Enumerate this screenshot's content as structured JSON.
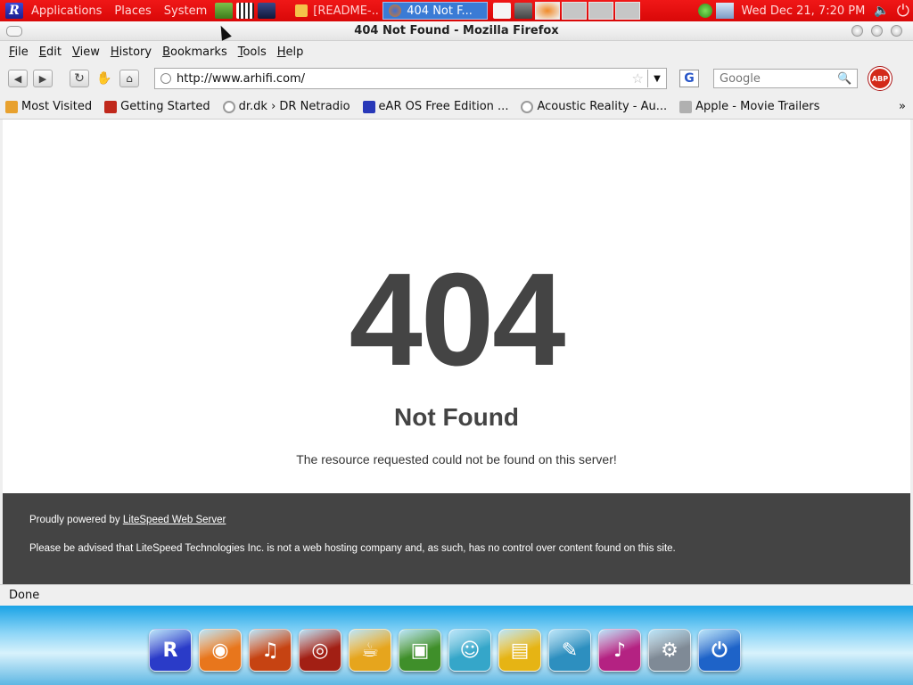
{
  "top_panel": {
    "menus": [
      "Applications",
      "Places",
      "System"
    ],
    "tasks": [
      {
        "label": "[README-...",
        "active": false
      },
      {
        "label": "404 Not F...",
        "active": true
      }
    ],
    "clock": "Wed Dec 21,  7:20 PM"
  },
  "window": {
    "title": "404 Not Found - Mozilla Firefox"
  },
  "menubar": [
    "File",
    "Edit",
    "View",
    "History",
    "Bookmarks",
    "Tools",
    "Help"
  ],
  "navbar": {
    "url": "http://www.arhifi.com/",
    "search_placeholder": "Google",
    "engine_letter": "G",
    "adblock_label": "ABP"
  },
  "bookmarks": [
    {
      "label": "Most Visited",
      "icon": "folder-icon",
      "color": "#e8a12e"
    },
    {
      "label": "Getting Started",
      "icon": "firefox-icon",
      "color": "#c0281b"
    },
    {
      "label": "dr.dk › DR Netradio",
      "icon": "globe-icon",
      "color": "#9a9a9a"
    },
    {
      "label": "eAR OS Free Edition ...",
      "icon": "ear-logo-icon",
      "color": "#2838b8"
    },
    {
      "label": "Acoustic Reality - Au...",
      "icon": "globe-icon",
      "color": "#9a9a9a"
    },
    {
      "label": "Apple - Movie Trailers",
      "icon": "apple-icon",
      "color": "#b0b0b0"
    }
  ],
  "bookmarks_more": "»",
  "page": {
    "code": "404",
    "title": "Not Found",
    "description": "The resource requested could not be found on this server!",
    "footer_prefix": "Proudly powered by ",
    "footer_link": "LiteSpeed Web Server",
    "footer_notice": "Please be advised that LiteSpeed Technologies Inc. is not a web hosting company and, as such, has no control over content found on this site."
  },
  "status": "Done",
  "dock": [
    {
      "name": "ear-logo-icon",
      "color": "#2a3bc8",
      "glyph": "R"
    },
    {
      "name": "firefox-icon",
      "color": "#e8761c",
      "glyph": "◉"
    },
    {
      "name": "guitar-icon",
      "color": "#c64312",
      "glyph": "♫"
    },
    {
      "name": "media-player-icon",
      "color": "#a21f14",
      "glyph": "◎"
    },
    {
      "name": "coffee-icon",
      "color": "#e6a51d",
      "glyph": "☕"
    },
    {
      "name": "image-viewer-icon",
      "color": "#3f8f2a",
      "glyph": "▣"
    },
    {
      "name": "messenger-icon",
      "color": "#35a6c9",
      "glyph": "☺"
    },
    {
      "name": "files-icon",
      "color": "#e6b414",
      "glyph": "▤"
    },
    {
      "name": "text-editor-icon",
      "color": "#2d8fbf",
      "glyph": "✎"
    },
    {
      "name": "music-icon",
      "color": "#b42282",
      "glyph": "♪"
    },
    {
      "name": "settings-icon",
      "color": "#7f8a96",
      "glyph": "⚙"
    },
    {
      "name": "power-icon",
      "color": "#1e63c8",
      "glyph": "⏻"
    }
  ]
}
